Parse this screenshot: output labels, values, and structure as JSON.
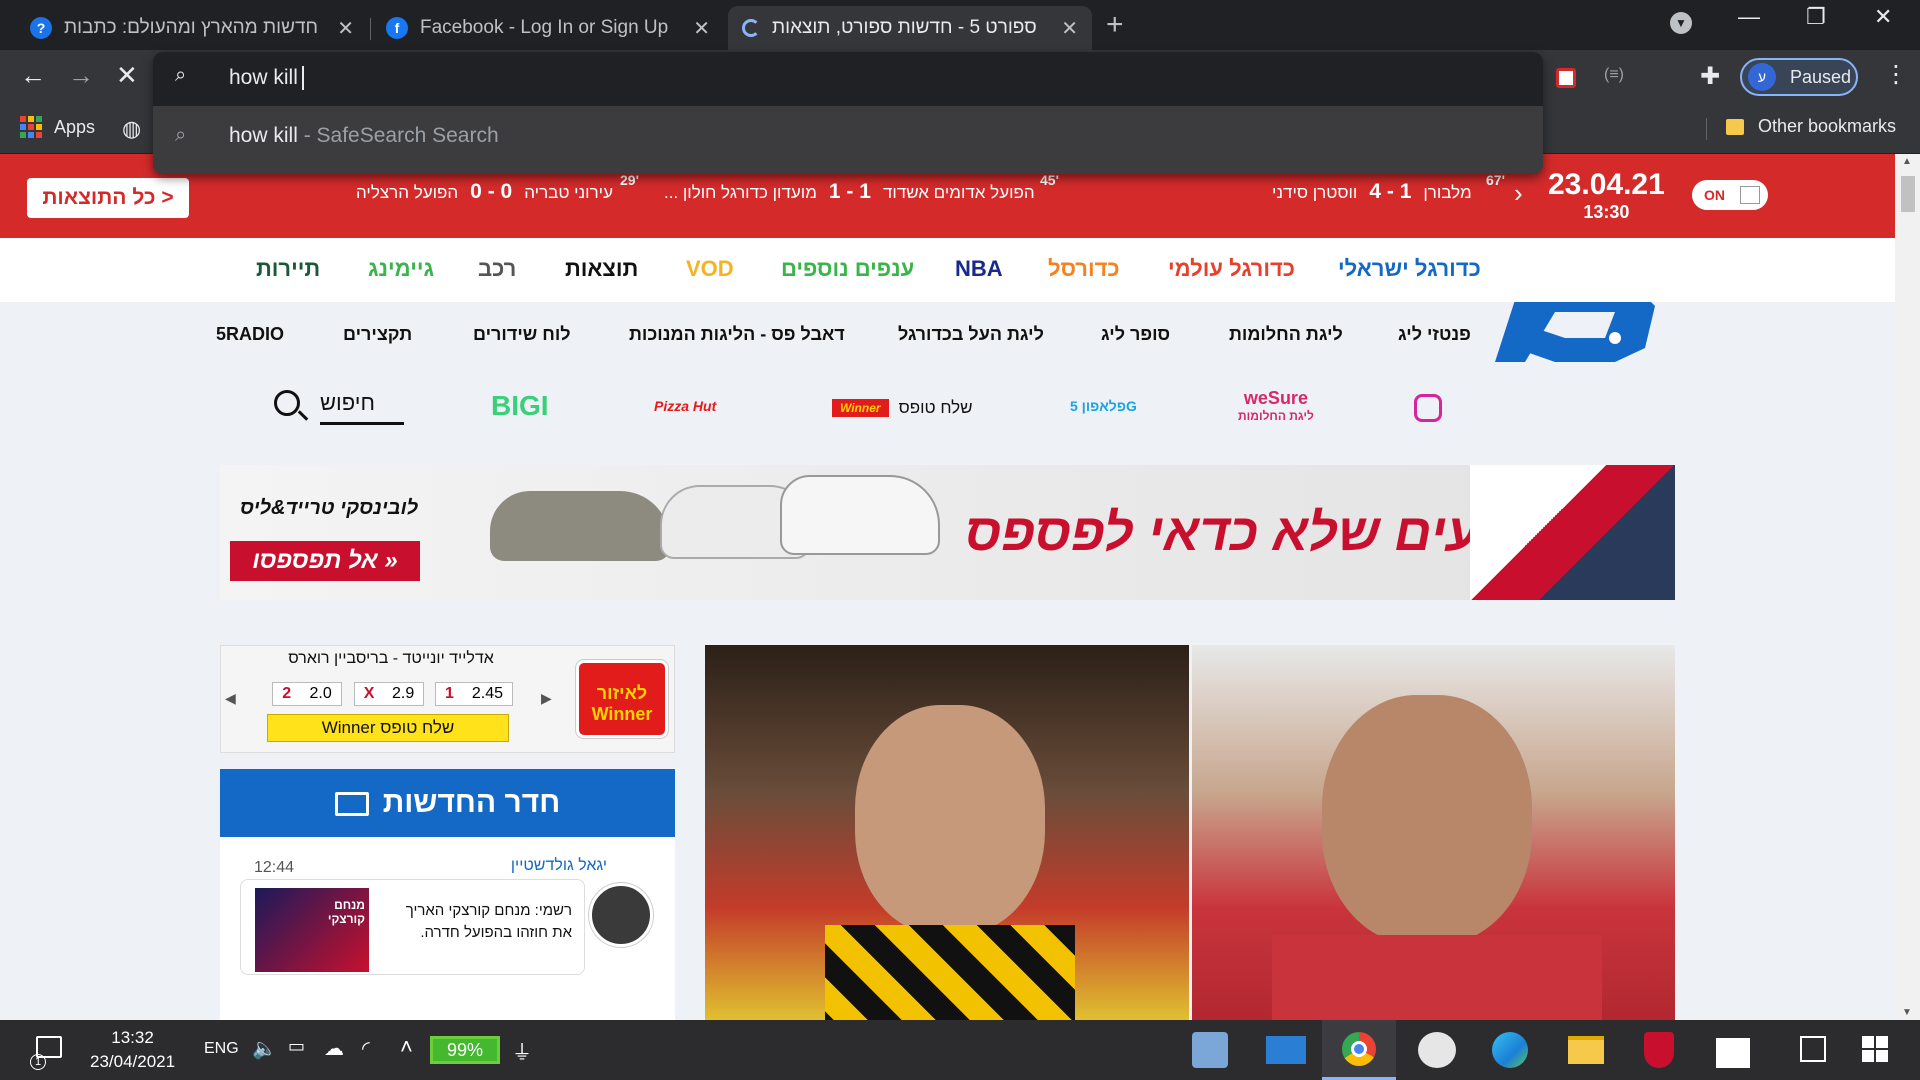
{
  "browser": {
    "tabs": [
      {
        "title": "חדשות מהארץ ומהעולם: כתבות ו",
        "icon": "news-icon"
      },
      {
        "title": "Facebook - Log In or Sign Up",
        "icon": "facebook-icon"
      },
      {
        "title": "ספורט 5 - חדשות ספורט, תוצאות",
        "icon": "loading-icon",
        "active": true
      }
    ],
    "omnibox_text": "how kill",
    "suggestion_query": "how kill",
    "suggestion_suffix": " - SafeSearch Search",
    "profile_status": "Paused",
    "profile_initial": "ע",
    "bookmarks": {
      "apps": "Apps",
      "other": "Other bookmarks"
    }
  },
  "scorebar": {
    "all_results": "כל התוצאות >",
    "date": "23.04.21",
    "time": "13:30",
    "on_label": "ON",
    "games": [
      {
        "minute": "67'",
        "home": "מלבורן",
        "score": "1 - 4",
        "away": "ווסטרן סידני"
      },
      {
        "minute": "45'",
        "home": "הפועל אדומים אשדוד",
        "score": "1 - 1",
        "away": "מועדון כדורגל חולון ..."
      },
      {
        "minute": "29'",
        "home": "עירוני טבריה",
        "score": "0 - 0",
        "away": "הפועל הרצליה"
      }
    ]
  },
  "main_nav": [
    {
      "label": "כדורגל ישראלי",
      "color": "#1468c6"
    },
    {
      "label": "כדורגל עולמי",
      "color": "#e8412b"
    },
    {
      "label": "כדורסל",
      "color": "#f5821f"
    },
    {
      "label": "NBA",
      "color": "#1a2a8c"
    },
    {
      "label": "ענפים נוספים",
      "color": "#3ab54a"
    },
    {
      "label": "VOD",
      "color": "#f5b323"
    },
    {
      "label": "תוצאות",
      "color": "#111111"
    },
    {
      "label": "רכב",
      "color": "#555555"
    },
    {
      "label": "גיימינג",
      "color": "#3ab54a"
    },
    {
      "label": "תיירות",
      "color": "#1a5a3a"
    }
  ],
  "sub_nav": [
    "פנטזי ליג",
    "ליגת החלומות",
    "סופר ליג",
    "ליגת העל בכדורגל",
    "דאבל פס - הליגות המנוכות",
    "לוח שידורים",
    "תקצירים",
    "5RADIO"
  ],
  "sponsors": {
    "wesure": "weSure",
    "wesure_sub": "ליגת החלומות",
    "pelephone": "פלאפון 5G",
    "winner_send": "שלח טופס",
    "winner_logo": "Winner",
    "pizzahut": "Pizza Hut",
    "bigi": "BIGI",
    "search_label": "חיפוש"
  },
  "banner": {
    "brand": "לובינסקי טרייד&ליס",
    "cta": "אל תפספסו »",
    "headline": "מבצעים שלא כדאי לפספס!"
  },
  "winner_widget": {
    "logo": "לאיזור Winner",
    "match": "אדלייד יונייטד - בריסביין רוארס",
    "odds": [
      {
        "label": "1",
        "value": "2.45"
      },
      {
        "label": "X",
        "value": "2.9"
      },
      {
        "label": "2",
        "value": "2.0"
      }
    ],
    "send_button": "שלח טופס Winner"
  },
  "newsroom": {
    "title": "חדר החדשות",
    "author": "יגאל גולדשטיין",
    "time": "12:44",
    "headline": "רשמי: מנחם קורצקי האריך את חוזהו בהפועל חדרה.",
    "thumb_label": "מנחם קורצקי"
  },
  "taskbar": {
    "time": "13:32",
    "date": "23/04/2021",
    "lang": "ENG",
    "battery": "99%",
    "notification_count": "1"
  }
}
